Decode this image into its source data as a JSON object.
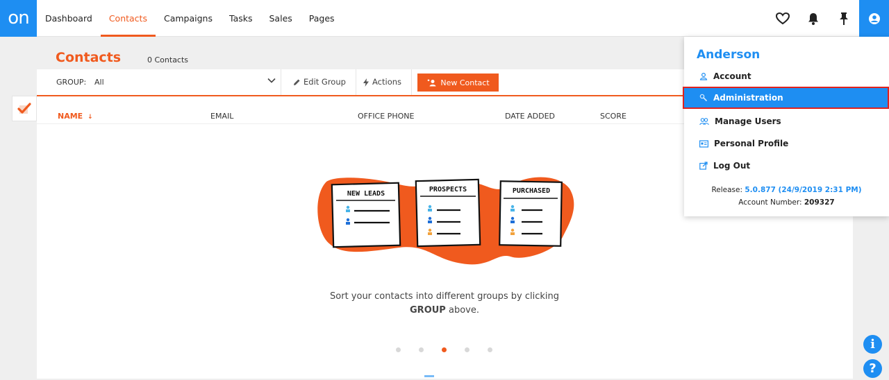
{
  "brand": {
    "logo_text": "on",
    "accent": "#f05a1e",
    "primary": "#1e8ef2"
  },
  "nav": {
    "items": [
      {
        "label": "Dashboard",
        "active": false
      },
      {
        "label": "Contacts",
        "active": true
      },
      {
        "label": "Campaigns",
        "active": false
      },
      {
        "label": "Tasks",
        "active": false
      },
      {
        "label": "Sales",
        "active": false
      },
      {
        "label": "Pages",
        "active": false
      }
    ],
    "icons": [
      "heart-icon",
      "bell-icon",
      "pin-icon",
      "user-icon"
    ]
  },
  "page": {
    "title": "Contacts",
    "count": "0 Contacts"
  },
  "toolbar": {
    "group_label": "GROUP:",
    "group_value": "All",
    "edit_group": "Edit Group",
    "actions": "Actions",
    "new_contact": "New Contact"
  },
  "columns": [
    {
      "label": "NAME",
      "sort": "↓",
      "sorted": true
    },
    {
      "label": "EMAIL"
    },
    {
      "label": "OFFICE PHONE"
    },
    {
      "label": "DATE ADDED"
    },
    {
      "label": "SCORE"
    }
  ],
  "illustration": {
    "cards": [
      "NEW LEADS",
      "PROSPECTS",
      "PURCHASED"
    ]
  },
  "empty_state": {
    "line1": "Sort your contacts into different groups by clicking",
    "bold": "GROUP",
    "suffix": " above."
  },
  "carousel": {
    "count": 5,
    "active_index": 2
  },
  "dropdown": {
    "user_name": "Anderson",
    "items": [
      {
        "label": "Account",
        "icon": "user-outline-icon",
        "highlighted": false
      },
      {
        "label": "Administration",
        "icon": "wrench-icon",
        "highlighted": true
      },
      {
        "label": "Manage Users",
        "icon": "users-icon",
        "highlighted": false
      },
      {
        "label": "Personal Profile",
        "icon": "id-card-icon",
        "highlighted": false
      },
      {
        "label": "Log Out",
        "icon": "logout-icon",
        "highlighted": false
      }
    ],
    "release_label": "Release:",
    "release_value": "5.0.877 (24/9/2019 2:31 PM)",
    "account_label": "Account Number:",
    "account_value": "209327"
  },
  "help": {
    "info": "i",
    "question": "?"
  }
}
